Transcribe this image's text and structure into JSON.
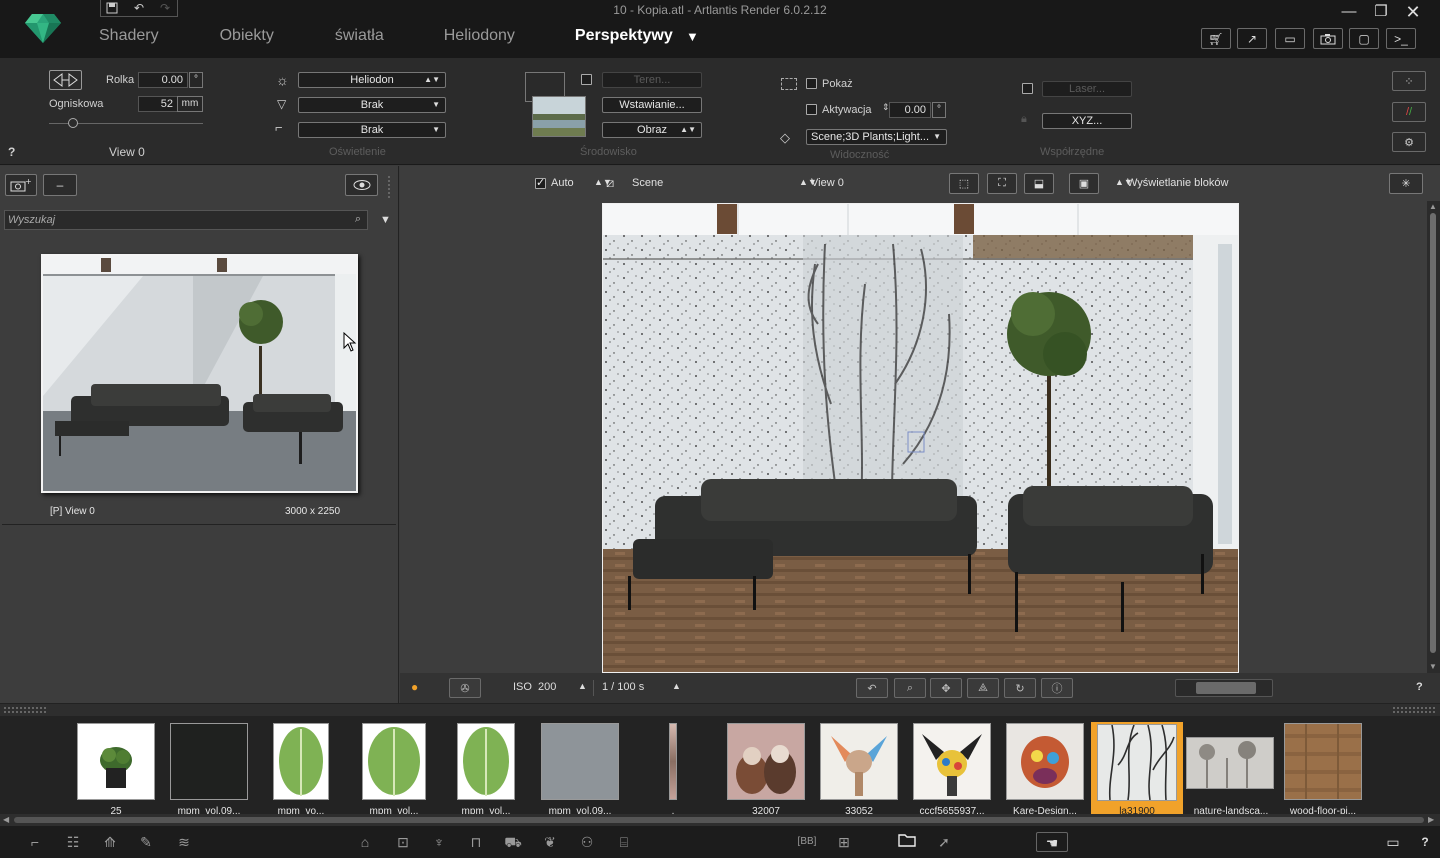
{
  "window": {
    "title": "10 - Kopia.atl - Artlantis Render 6.0.2.12"
  },
  "menu": {
    "tabs": [
      {
        "label": "Shadery"
      },
      {
        "label": "Obiekty"
      },
      {
        "label": "światła"
      },
      {
        "label": "Heliodony"
      },
      {
        "label": "Perspektywy"
      }
    ],
    "active": "Perspektywy"
  },
  "camera": {
    "roll_label": "Rolka",
    "roll_value": "0.00",
    "roll_unit": "°",
    "focal_label": "Ogniskowa",
    "focal_value": "52",
    "focal_unit": "mm",
    "view_name": "View 0",
    "help": "?"
  },
  "lighting": {
    "heliodon": "Heliodon",
    "light1": "Brak",
    "light2": "Brak",
    "group_label": "Oświetlenie"
  },
  "environment": {
    "terrain": "Teren...",
    "insert": "Wstawianie...",
    "image": "Obraz",
    "group_label": "Środowisko"
  },
  "visibility": {
    "show_label": "Pokaż",
    "activation_label": "Aktywacja",
    "activation_value": "0.00",
    "activation_unit": "°",
    "layers": "Scene;3D Plants;Light...",
    "group_label": "Widoczność"
  },
  "coordinates": {
    "laser": "Laser...",
    "xyz": "XYZ...",
    "group_label": "Współrzędne"
  },
  "left_panel": {
    "search_placeholder": "Wyszukaj",
    "thumb_label": "[P]  View 0",
    "thumb_size": "3000 x 2250"
  },
  "view_toolbar": {
    "auto_label": "Auto",
    "scene_label": "Scene",
    "view_label": "View 0",
    "display_label": "Wyświetlanie bloków"
  },
  "exposure": {
    "iso_label": "ISO",
    "iso_value": "200",
    "shutter": "1 /  100 s",
    "help": "?"
  },
  "materials": [
    {
      "label": "25",
      "kind": "plant"
    },
    {
      "label": "mpm_vol.09...",
      "kind": "granite"
    },
    {
      "label": "mpm_vo...",
      "kind": "leaf"
    },
    {
      "label": "mpm_vol...",
      "kind": "leaf"
    },
    {
      "label": "mpm_vol...",
      "kind": "leaf"
    },
    {
      "label": "mpm_vol.09...",
      "kind": "concrete"
    },
    {
      "label": ".",
      "kind": "strip"
    },
    {
      "label": "32007",
      "kind": "dogs"
    },
    {
      "label": "33052",
      "kind": "chihuahua"
    },
    {
      "label": "cccf5655937...",
      "kind": "popdog"
    },
    {
      "label": "Kare-Design...",
      "kind": "popdog2"
    },
    {
      "label": "la31900",
      "kind": "branches",
      "selected": true
    },
    {
      "label": "nature-landsca...",
      "kind": "fog"
    },
    {
      "label": "wood-floor-pi...",
      "kind": "wood"
    }
  ],
  "colors": {
    "accent": "#f1a22a",
    "background": "#3b3b3b",
    "menu_bg": "#181818"
  }
}
